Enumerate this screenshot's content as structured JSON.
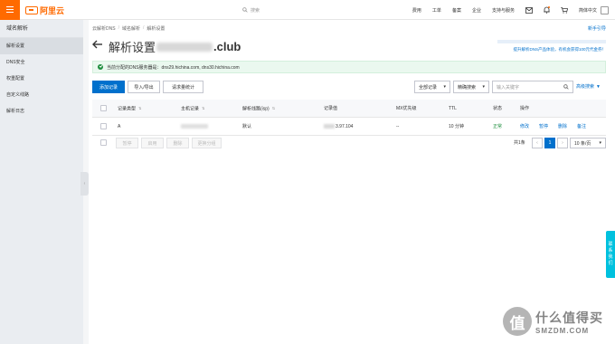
{
  "header": {
    "logo_text": "阿里云",
    "search_placeholder": "搜索",
    "nav": [
      "费用",
      "工单",
      "备案",
      "企业",
      "支持与服务"
    ],
    "language": "简体中文",
    "colors": {
      "brand": "#ff6a00",
      "primary": "#0070cc",
      "success": "#1e8e3e"
    }
  },
  "sidebar": {
    "title": "域名解析",
    "items": [
      {
        "label": "解析设置",
        "active": true
      },
      {
        "label": "DNS安全"
      },
      {
        "label": "权重配置"
      },
      {
        "label": "自定义线路"
      },
      {
        "label": "解析日志"
      }
    ]
  },
  "breadcrumb": [
    "云解析DNS",
    "域名解析",
    "解析设置"
  ],
  "guide_link": "新手引导",
  "page": {
    "title_prefix": "解析设置",
    "title_suffix": ".club",
    "promo_text": "提升解析DNS产品体验，有机会获得100元代金券！"
  },
  "notice": {
    "text": "当前分配的DNS服务器是：dns29.hichina.com, dns30.hichina.com"
  },
  "toolbar": {
    "add_record": "添加记录",
    "import_export": "导入/导出",
    "request_stats": "请求量统计",
    "filter_all": "全部记录",
    "search_mode": "精确搜索",
    "search_placeholder": "输入关键字",
    "advanced_search": "高级搜索"
  },
  "table": {
    "columns": [
      "记录类型",
      "主机记录",
      "解析线路(isp)",
      "记录值",
      "MX优先级",
      "TTL",
      "状态",
      "操作"
    ],
    "rows": [
      {
        "type": "A",
        "host": "",
        "line": "默认",
        "value_visible": "3.97.104",
        "mx": "--",
        "ttl": "10 分钟",
        "status": "正常",
        "actions": [
          "修改",
          "暂停",
          "删除",
          "备注"
        ]
      }
    ]
  },
  "footer": {
    "bulk_actions": [
      "暂停",
      "启用",
      "删除",
      "更换分组"
    ],
    "total": "共1条",
    "current_page": "1",
    "page_size": "10 条/页"
  },
  "contact_tab": [
    "联",
    "系",
    "我",
    "们"
  ],
  "watermark": {
    "badge": "值",
    "cn": "什么值得买",
    "en": "SMZDM.COM"
  }
}
